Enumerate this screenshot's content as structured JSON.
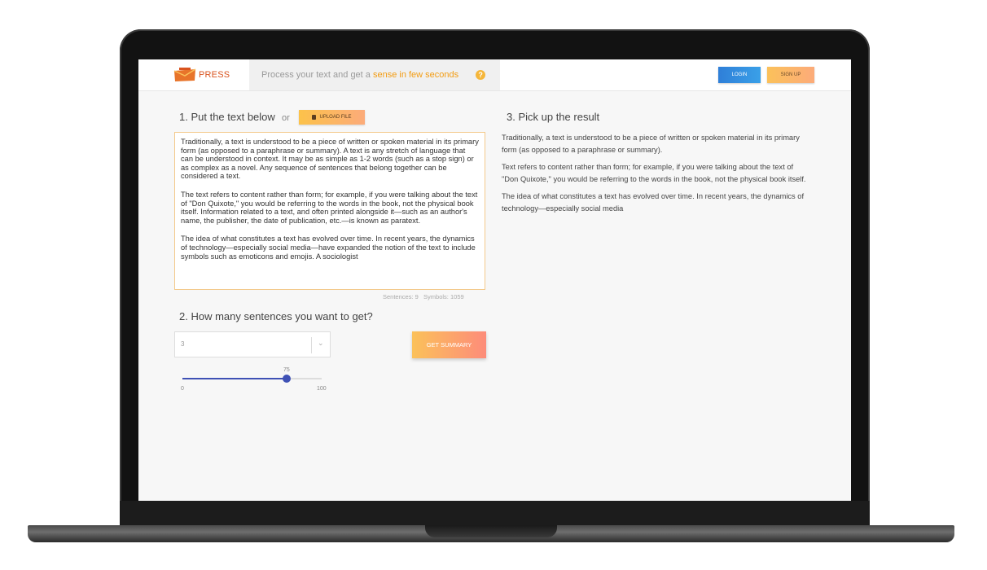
{
  "header": {
    "logo_text": "PRESS",
    "tagline_plain": "Process your text and get a ",
    "tagline_accent": "sense in few seconds",
    "help_glyph": "?",
    "login_label": "LOGIN",
    "signup_label": "SIGN UP"
  },
  "step1": {
    "title": "1. Put the text below",
    "or": "or",
    "upload_label": "UPLOAD FILE"
  },
  "input_text": [
    "Traditionally, a text is understood to be a piece of written or spoken material in its primary form (as opposed to a paraphrase or summary). A text is any stretch of language that can be understood in context. It may be as simple as 1-2 words (such as a stop sign) or as complex as a novel. Any sequence of sentences that belong together can be considered a text.",
    "The text refers to content rather than form; for example, if you were talking about the text of \"Don Quixote,\" you would be referring to the words in the book, not the physical book itself. Information related to a text, and often printed alongside it—such as an author's name, the publisher, the date of publication, etc.—is known as paratext.",
    "The idea of what constitutes a text has evolved over time. In recent years, the dynamics of technology—especially social media—have expanded the notion of the text to include symbols such as emoticons and emojis. A sociologist"
  ],
  "counter": {
    "sentences_label": "Sentences: 9",
    "symbols_label": "Symbols: 1059"
  },
  "step2": {
    "title": "2. How many sentences you want to get?",
    "select_value": "3",
    "summary_button": "GET SUMMARY"
  },
  "slider": {
    "value": 75,
    "min": 0,
    "max": 100,
    "value_label": "75",
    "min_label": "0",
    "max_label": "100"
  },
  "step3": {
    "title": "3. Pick up the result"
  },
  "result_text": [
    "Traditionally, a text is understood to be a piece of written or spoken material in its primary form (as opposed to a paraphrase or summary).",
    "Text refers to content rather than form; for example, if you were talking about the text of \"Don Quixote,\" you would be referring to the words in the book, not the physical book itself.",
    "The idea of what constitutes a text has evolved over time. In recent years, the dynamics of technology—especially social media"
  ],
  "colors": {
    "accent": "#f39c12",
    "login": "#2f7fd8",
    "slider": "#3f51b5"
  }
}
